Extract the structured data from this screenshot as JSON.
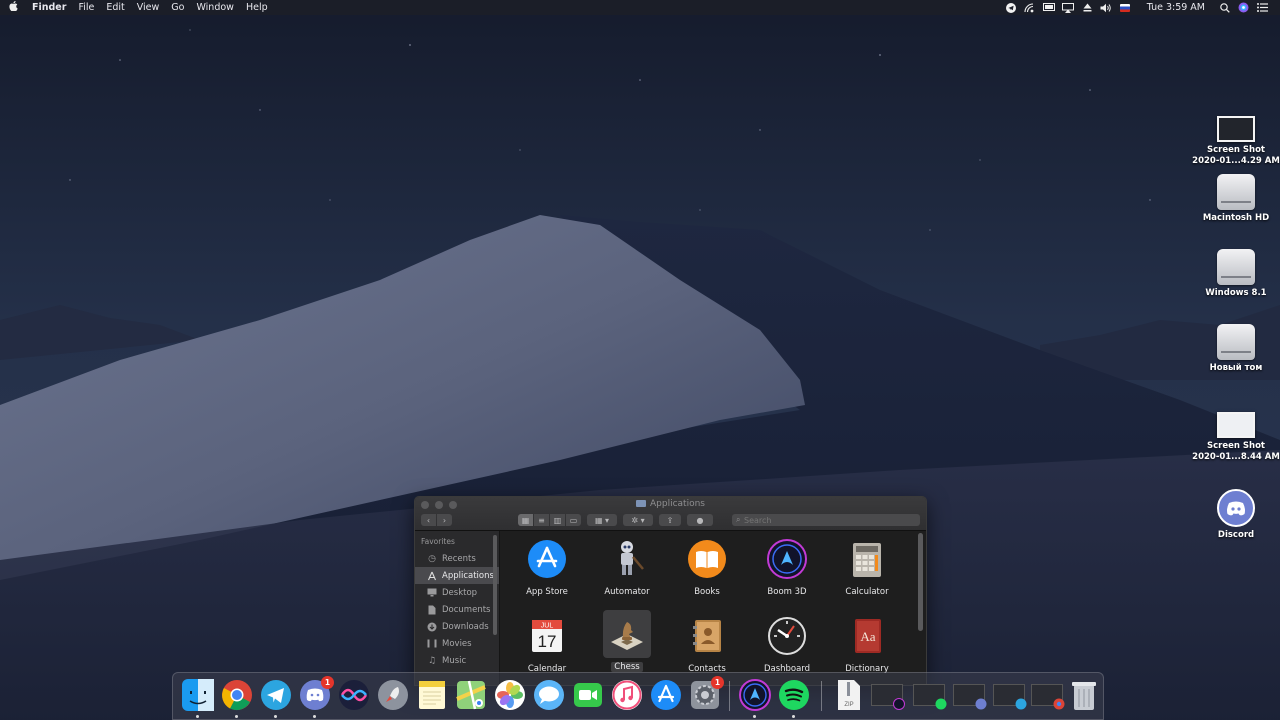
{
  "menubar": {
    "app_name": "Finder",
    "menus": [
      "File",
      "Edit",
      "View",
      "Go",
      "Window",
      "Help"
    ],
    "clock": "Tue 3:59 AM",
    "status_icons": [
      "telegram-icon",
      "wifi-signal-icon",
      "display-icon",
      "airplay-icon",
      "eject-icon",
      "volume-icon",
      "input-flag-icon",
      "search-icon",
      "siri-icon",
      "notification-center-icon"
    ]
  },
  "desktop": {
    "icons": [
      {
        "line1": "Screen Shot",
        "line2": "2020-01...4.29 AM",
        "kind": "screenshot-dark"
      },
      {
        "line1": "Macintosh HD",
        "line2": "",
        "kind": "drive"
      },
      {
        "line1": "Windows 8.1",
        "line2": "",
        "kind": "drive"
      },
      {
        "line1": "Новый том",
        "line2": "",
        "kind": "drive"
      },
      {
        "line1": "Screen Shot",
        "line2": "2020-01...8.44 AM",
        "kind": "screenshot-light"
      },
      {
        "line1": "Discord",
        "line2": "",
        "kind": "discord"
      }
    ]
  },
  "finder": {
    "title": "Applications",
    "search_placeholder": "Search",
    "sidebar_heading": "Favorites",
    "sidebar": [
      {
        "label": "Recents",
        "icon": "clock-icon",
        "active": false
      },
      {
        "label": "Applications",
        "icon": "applications-icon",
        "active": true
      },
      {
        "label": "Desktop",
        "icon": "desktop-icon",
        "active": false
      },
      {
        "label": "Documents",
        "icon": "document-icon",
        "active": false
      },
      {
        "label": "Downloads",
        "icon": "download-icon",
        "active": false
      },
      {
        "label": "Movies",
        "icon": "film-icon",
        "active": false
      },
      {
        "label": "Music",
        "icon": "music-note-icon",
        "active": false
      }
    ],
    "apps": [
      {
        "label": "App Store",
        "icon": "app-store-icon"
      },
      {
        "label": "Automator",
        "icon": "automator-robot-icon"
      },
      {
        "label": "Books",
        "icon": "books-icon"
      },
      {
        "label": "Boom 3D",
        "icon": "boom-3d-icon"
      },
      {
        "label": "Calculator",
        "icon": "calculator-icon"
      },
      {
        "label": "Calendar",
        "icon": "calendar-icon",
        "sub_month": "JUL",
        "sub_day": "17"
      },
      {
        "label": "Chess",
        "icon": "chess-icon",
        "selected": true
      },
      {
        "label": "Contacts",
        "icon": "contacts-icon"
      },
      {
        "label": "Dashboard",
        "icon": "dashboard-icon"
      },
      {
        "label": "Dictionary",
        "icon": "dictionary-icon",
        "glyph": "Aa"
      }
    ]
  },
  "dock": {
    "apps": [
      {
        "name": "finder-icon",
        "running": true
      },
      {
        "name": "chrome-icon",
        "running": true
      },
      {
        "name": "telegram-icon",
        "running": true
      },
      {
        "name": "discord-icon",
        "running": true,
        "badge": "1"
      },
      {
        "name": "siri-icon",
        "running": false
      },
      {
        "name": "launchpad-icon",
        "running": false
      },
      {
        "name": "notes-icon",
        "running": false
      },
      {
        "name": "maps-icon",
        "running": false
      },
      {
        "name": "photos-icon",
        "running": false
      },
      {
        "name": "messages-icon",
        "running": false
      },
      {
        "name": "facetime-icon",
        "running": false
      },
      {
        "name": "itunes-icon",
        "running": false
      },
      {
        "name": "app-store-icon",
        "running": false
      },
      {
        "name": "system-preferences-icon",
        "running": false,
        "badge": "1"
      },
      {
        "name": "boom-3d-icon",
        "running": true
      },
      {
        "name": "spotify-icon",
        "running": true
      }
    ],
    "zip_label": "ZIP",
    "minimized": [
      "boom-3d-window",
      "spotify-window",
      "discord-window",
      "telegram-window",
      "chrome-window"
    ]
  },
  "colors": {
    "accent_red": "#e5352b",
    "app_store_blue": "#1d8cf8",
    "spotify_green": "#1ed760",
    "discord_blurple": "#6e7fd1"
  }
}
